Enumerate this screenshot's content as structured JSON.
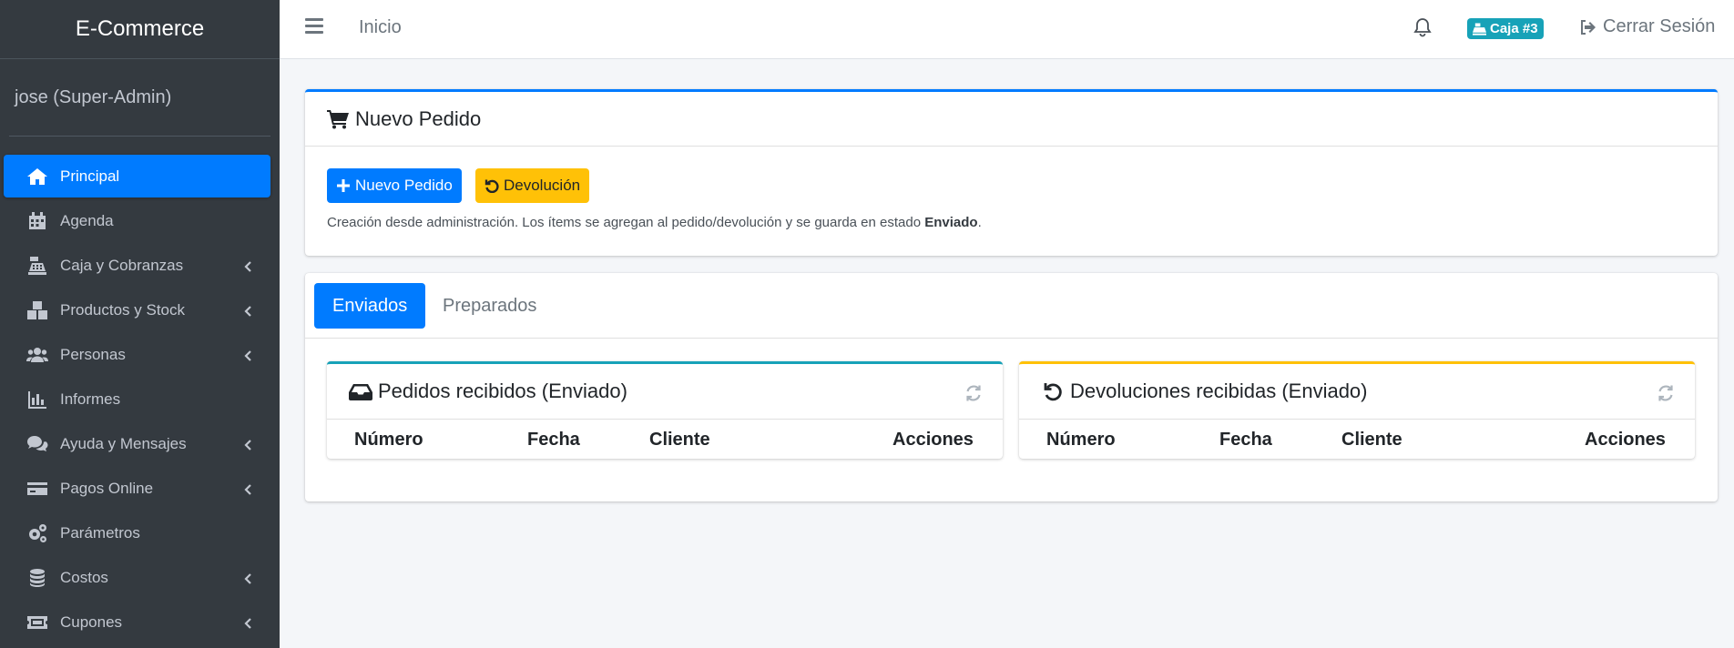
{
  "app": {
    "brand": "E-Commerce",
    "user": "jose (Super-Admin)"
  },
  "sidebar": {
    "items": [
      {
        "label": "Principal",
        "icon": "home-icon",
        "active": true,
        "caret": false
      },
      {
        "label": "Agenda",
        "icon": "calendar-icon",
        "active": false,
        "caret": false
      },
      {
        "label": "Caja y Cobranzas",
        "icon": "cash-register-icon",
        "active": false,
        "caret": true
      },
      {
        "label": "Productos y Stock",
        "icon": "boxes-icon",
        "active": false,
        "caret": true
      },
      {
        "label": "Personas",
        "icon": "users-icon",
        "active": false,
        "caret": true
      },
      {
        "label": "Informes",
        "icon": "chart-bar-icon",
        "active": false,
        "caret": false
      },
      {
        "label": "Ayuda y Mensajes",
        "icon": "comments-icon",
        "active": false,
        "caret": true
      },
      {
        "label": "Pagos Online",
        "icon": "credit-card-icon",
        "active": false,
        "caret": true
      },
      {
        "label": "Parámetros",
        "icon": "cogs-icon",
        "active": false,
        "caret": false
      },
      {
        "label": "Costos",
        "icon": "coins-icon",
        "active": false,
        "caret": true
      },
      {
        "label": "Cupones",
        "icon": "ticket-icon",
        "active": false,
        "caret": true
      }
    ]
  },
  "topbar": {
    "home": "Inicio",
    "caja_badge": "Caja #3",
    "logout": "Cerrar Sesión"
  },
  "nuevo_pedido": {
    "title": "Nuevo Pedido",
    "btn_new": "Nuevo Pedido",
    "btn_return": "Devolución",
    "help_prefix": "Creación desde administración. Los ítems se agregan al pedido/devolución y se guarda en estado ",
    "help_bold": "Enviado",
    "help_suffix": "."
  },
  "tabs": {
    "sent": "Enviados",
    "prepared": "Preparados"
  },
  "pedidos_card": {
    "title": "Pedidos recibidos (Enviado)",
    "columns": [
      "Número",
      "Fecha",
      "Cliente",
      "Acciones"
    ]
  },
  "devoluciones_card": {
    "title": "Devoluciones recibidas (Enviado)",
    "columns": [
      "Número",
      "Fecha",
      "Cliente",
      "Acciones"
    ]
  },
  "colors": {
    "primary": "#007bff",
    "warning": "#ffc107",
    "info": "#17a2b8",
    "sidebar": "#343a40"
  }
}
